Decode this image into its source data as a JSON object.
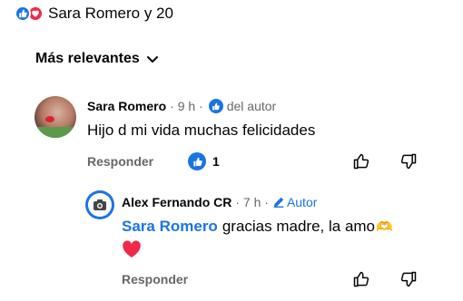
{
  "reactions": {
    "summary": "Sara Romero y 20",
    "icons": [
      "like-reaction-icon",
      "love-reaction-icon"
    ],
    "colors": {
      "like": "#1b74e4",
      "love": "#f0284a"
    }
  },
  "sort": {
    "label": "Más relevantes",
    "icon": "chevron-down-icon"
  },
  "comments": [
    {
      "author": "Sara Romero",
      "time": "· 9 h ·",
      "liked_by_author_label": "del autor",
      "text": "Hijo d mi vida muchas felicidades",
      "reply_label": "Responder",
      "reaction_count": "1",
      "icons": [
        "thumbs-up-icon",
        "thumbs-down-icon"
      ]
    },
    {
      "author": "Alex Fernando CR",
      "time": "· 7 h ·",
      "author_tag": "Autor",
      "mention": "Sara Romero",
      "text": "gracias madre, la amo",
      "emoji_1": "🫶",
      "emoji_2": "❤️",
      "reply_label": "Responder",
      "icons": [
        "thumbs-up-icon",
        "thumbs-down-icon"
      ]
    }
  ],
  "colors": {
    "accent": "#1b74e4",
    "text": "#050505",
    "secondary": "#65676b"
  }
}
